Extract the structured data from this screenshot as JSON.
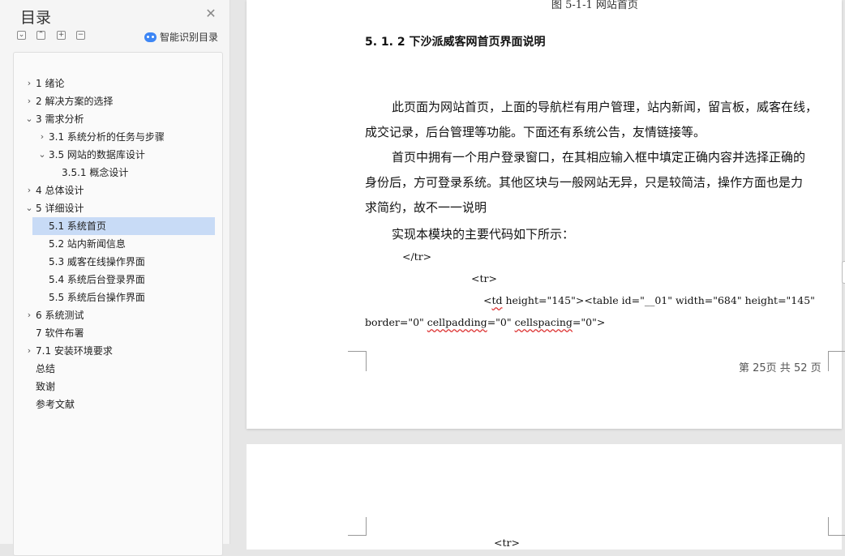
{
  "sidebar": {
    "title": "目录",
    "smart_label": "智能识别目录",
    "tools": [
      "⌄",
      "⌃",
      "+",
      "−"
    ],
    "items": [
      {
        "label": "1  绪论",
        "chevron": "›"
      },
      {
        "label": "2  解决方案的选择",
        "chevron": "›"
      },
      {
        "label": "3  需求分析",
        "chevron": "⌄"
      },
      {
        "label": "3.1 系统分析的任务与步骤",
        "chevron": "›"
      },
      {
        "label": "3.5 网站的数据库设计",
        "chevron": "⌄"
      },
      {
        "label": "3.5.1  概念设计",
        "chevron": ""
      },
      {
        "label": "4  总体设计",
        "chevron": "›"
      },
      {
        "label": "5  详细设计",
        "chevron": "⌄"
      },
      {
        "label": "5.1  系统首页",
        "chevron": ""
      },
      {
        "label": "5.2  站内新闻信息",
        "chevron": ""
      },
      {
        "label": "5.3 威客在线操作界面",
        "chevron": ""
      },
      {
        "label": "5.4 系统后台登录界面",
        "chevron": ""
      },
      {
        "label": "5.5 系统后台操作界面",
        "chevron": ""
      },
      {
        "label": "6  系统测试",
        "chevron": "›"
      },
      {
        "label": "7  软件布署",
        "chevron": ""
      },
      {
        "label": "7.1 安装环境要求",
        "chevron": "›"
      },
      {
        "label": "总结",
        "chevron": ""
      },
      {
        "label": "致谢",
        "chevron": ""
      },
      {
        "label": "参考文献",
        "chevron": ""
      }
    ]
  },
  "document": {
    "caption": "图 5-1-1 网站首页",
    "heading": "5. 1. 2  下沙派威客网首页界面说明",
    "paragraphs": [
      "此页面为网站首页，上面的导航栏有用户管理，站内新闻，留言板，威客在线，",
      "成交记录，后台管理等功能。下面还有系统公告，友情链接等。",
      "首页中拥有一个用户登录窗口，在其相应输入框中填定正确内容并选择正确的",
      "身份后，方可登录系统。其他区块与一般网站无异，只是较简洁，操作方面也是力",
      "求简约，故不一一说明",
      "实现本模块的主要代码如下所示："
    ],
    "code": {
      "line1": "</tr>",
      "line2": "<tr>",
      "line3a": "<",
      "line3b": "td",
      "line3c": "  height=\"145\"><table  id=\"__01\"  width=\"684\"  height=\"145\"",
      "line4a": "border=\"0\"  ",
      "line4b": "cellpadding",
      "line4c": "=\"0\"  ",
      "line4d": "cellspacing",
      "line4e": "=\"0\">",
      "page2_line": "<tr>"
    },
    "footer": "第 25页   共 52 页"
  },
  "colors": {
    "accent": "#3d86f5",
    "selected": "#c8dbf6"
  }
}
